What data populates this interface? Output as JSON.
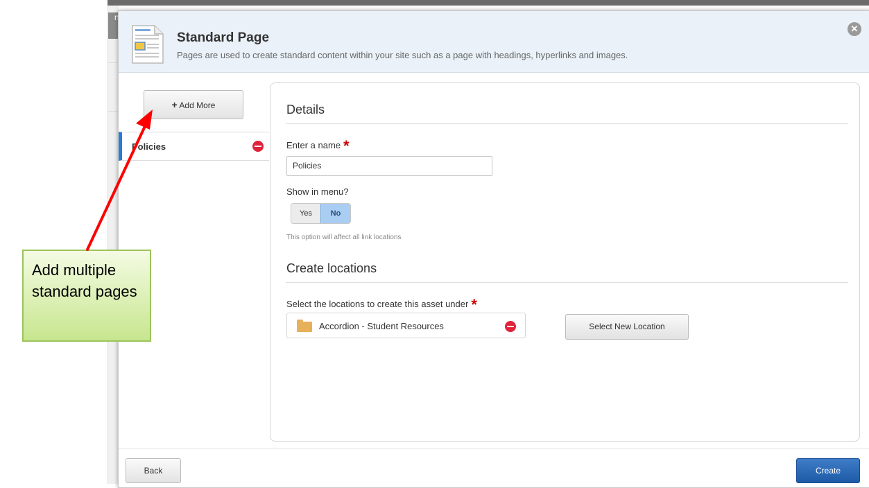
{
  "background": {
    "glyph": "n"
  },
  "dialog": {
    "title": "Standard Page",
    "description": "Pages are used to create standard content within your site such as a page with headings, hyperlinks and images.",
    "close_icon": "close-circle-icon"
  },
  "sidebar": {
    "add_more_plus": "+",
    "add_more_label": " Add More",
    "items": [
      {
        "label": "Policies",
        "remove_icon": "remove-circle-icon"
      }
    ]
  },
  "details": {
    "title": "Details",
    "name_label": "Enter a name",
    "required_mark": "*",
    "name_value": "Policies",
    "menu_label": "Show in menu?",
    "toggle": {
      "yes": "Yes",
      "no": "No",
      "selected": "No"
    },
    "hint": "This option will affect all link locations"
  },
  "locations": {
    "title": "Create locations",
    "select_label": "Select the locations to create this asset under",
    "required_mark": "*",
    "items": [
      {
        "label": "Accordion - Student Resources",
        "icon": "folder-icon"
      }
    ],
    "select_button": "Select New Location"
  },
  "footer": {
    "back": "Back",
    "create": "Create"
  },
  "callout": {
    "text": "Add multiple standard pages",
    "arrow_color": "#ff0000",
    "fill": "#d9f0a9"
  }
}
